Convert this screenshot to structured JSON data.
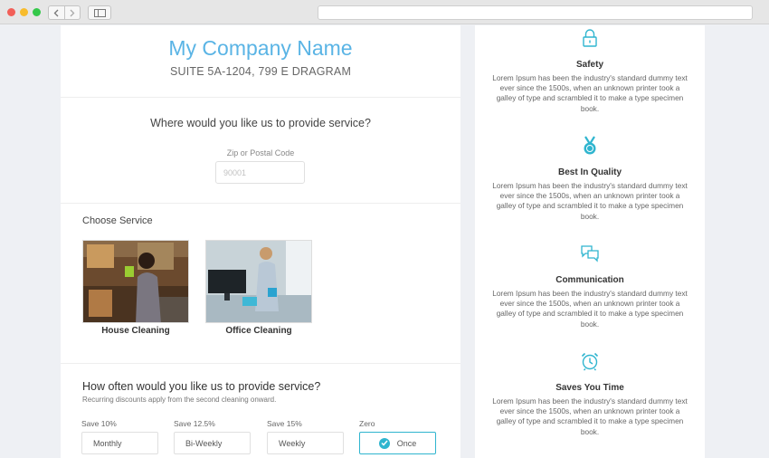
{
  "company": {
    "name": "My Company Name",
    "address": "SUITE 5A-1204, 799 E DRAGRAM"
  },
  "location": {
    "question": "Where would you like us to provide service?",
    "zip_label": "Zip or Postal Code",
    "zip_placeholder": "90001"
  },
  "services": {
    "heading": "Choose Service",
    "items": [
      {
        "label": "House Cleaning"
      },
      {
        "label": "Office Cleaning"
      }
    ]
  },
  "frequency": {
    "question": "How often would you like us to provide service?",
    "subtitle": "Recurring discounts apply from the second cleaning onward.",
    "options": [
      {
        "discount": "Save 10%",
        "label": "Monthly",
        "selected": false
      },
      {
        "discount": "Save 12.5%",
        "label": "Bi-Weekly",
        "selected": false
      },
      {
        "discount": "Save 15%",
        "label": "Weekly",
        "selected": false
      },
      {
        "discount": "Zero",
        "label": "Once",
        "selected": true
      }
    ]
  },
  "features": [
    {
      "icon": "lock-icon",
      "title": "Safety",
      "description": "Lorem Ipsum has been the industry's standard dummy text ever since the 1500s, when an unknown printer took a galley of type and scrambled it to make a type specimen book."
    },
    {
      "icon": "medal-icon",
      "title": "Best In Quality",
      "description": "Lorem Ipsum has been the industry's standard dummy text ever since the 1500s, when an unknown printer took a galley of type and scrambled it to make a type specimen book."
    },
    {
      "icon": "chat-icon",
      "title": "Communication",
      "description": "Lorem Ipsum has been the industry's standard dummy text ever since the 1500s, when an unknown printer took a galley of type and scrambled it to make a type specimen book."
    },
    {
      "icon": "alarm-clock-icon",
      "title": "Saves You Time",
      "description": "Lorem Ipsum has been the industry's standard dummy text ever since the 1500s, when an unknown printer took a galley of type and scrambled it to make a type specimen book."
    }
  ],
  "colors": {
    "accent": "#2fb5cf",
    "title_blue": "#5ab4e5",
    "page_bg": "#eef0f4"
  }
}
